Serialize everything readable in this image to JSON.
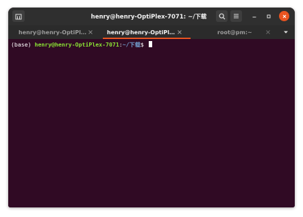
{
  "window": {
    "title": "henry@henry-OptiPlex-7071: ~/下载"
  },
  "tabs": [
    {
      "label": "henry@henry-OptiPl…",
      "active": false
    },
    {
      "label": "henry@henry-OptiPl…",
      "active": true
    },
    {
      "label": "root@pm:~",
      "active": false
    }
  ],
  "terminal": {
    "prompt_env": "(base) ",
    "prompt_user": "henry@henry-OptiPlex-7071",
    "prompt_colon": ":",
    "prompt_path": "~/下载",
    "prompt_dollar": "$ "
  },
  "icons": {
    "new_tab": "new-tab-icon",
    "search": "search-icon",
    "menu": "hamburger-menu-icon",
    "minimize": "minimize-icon",
    "maximize": "maximize-icon",
    "close": "close-icon",
    "tab_list": "chevron-down-icon"
  },
  "colors": {
    "accent": "#e95420",
    "terminal_bg": "#300a24",
    "user_host": "#8ae234",
    "path": "#729fcf"
  }
}
